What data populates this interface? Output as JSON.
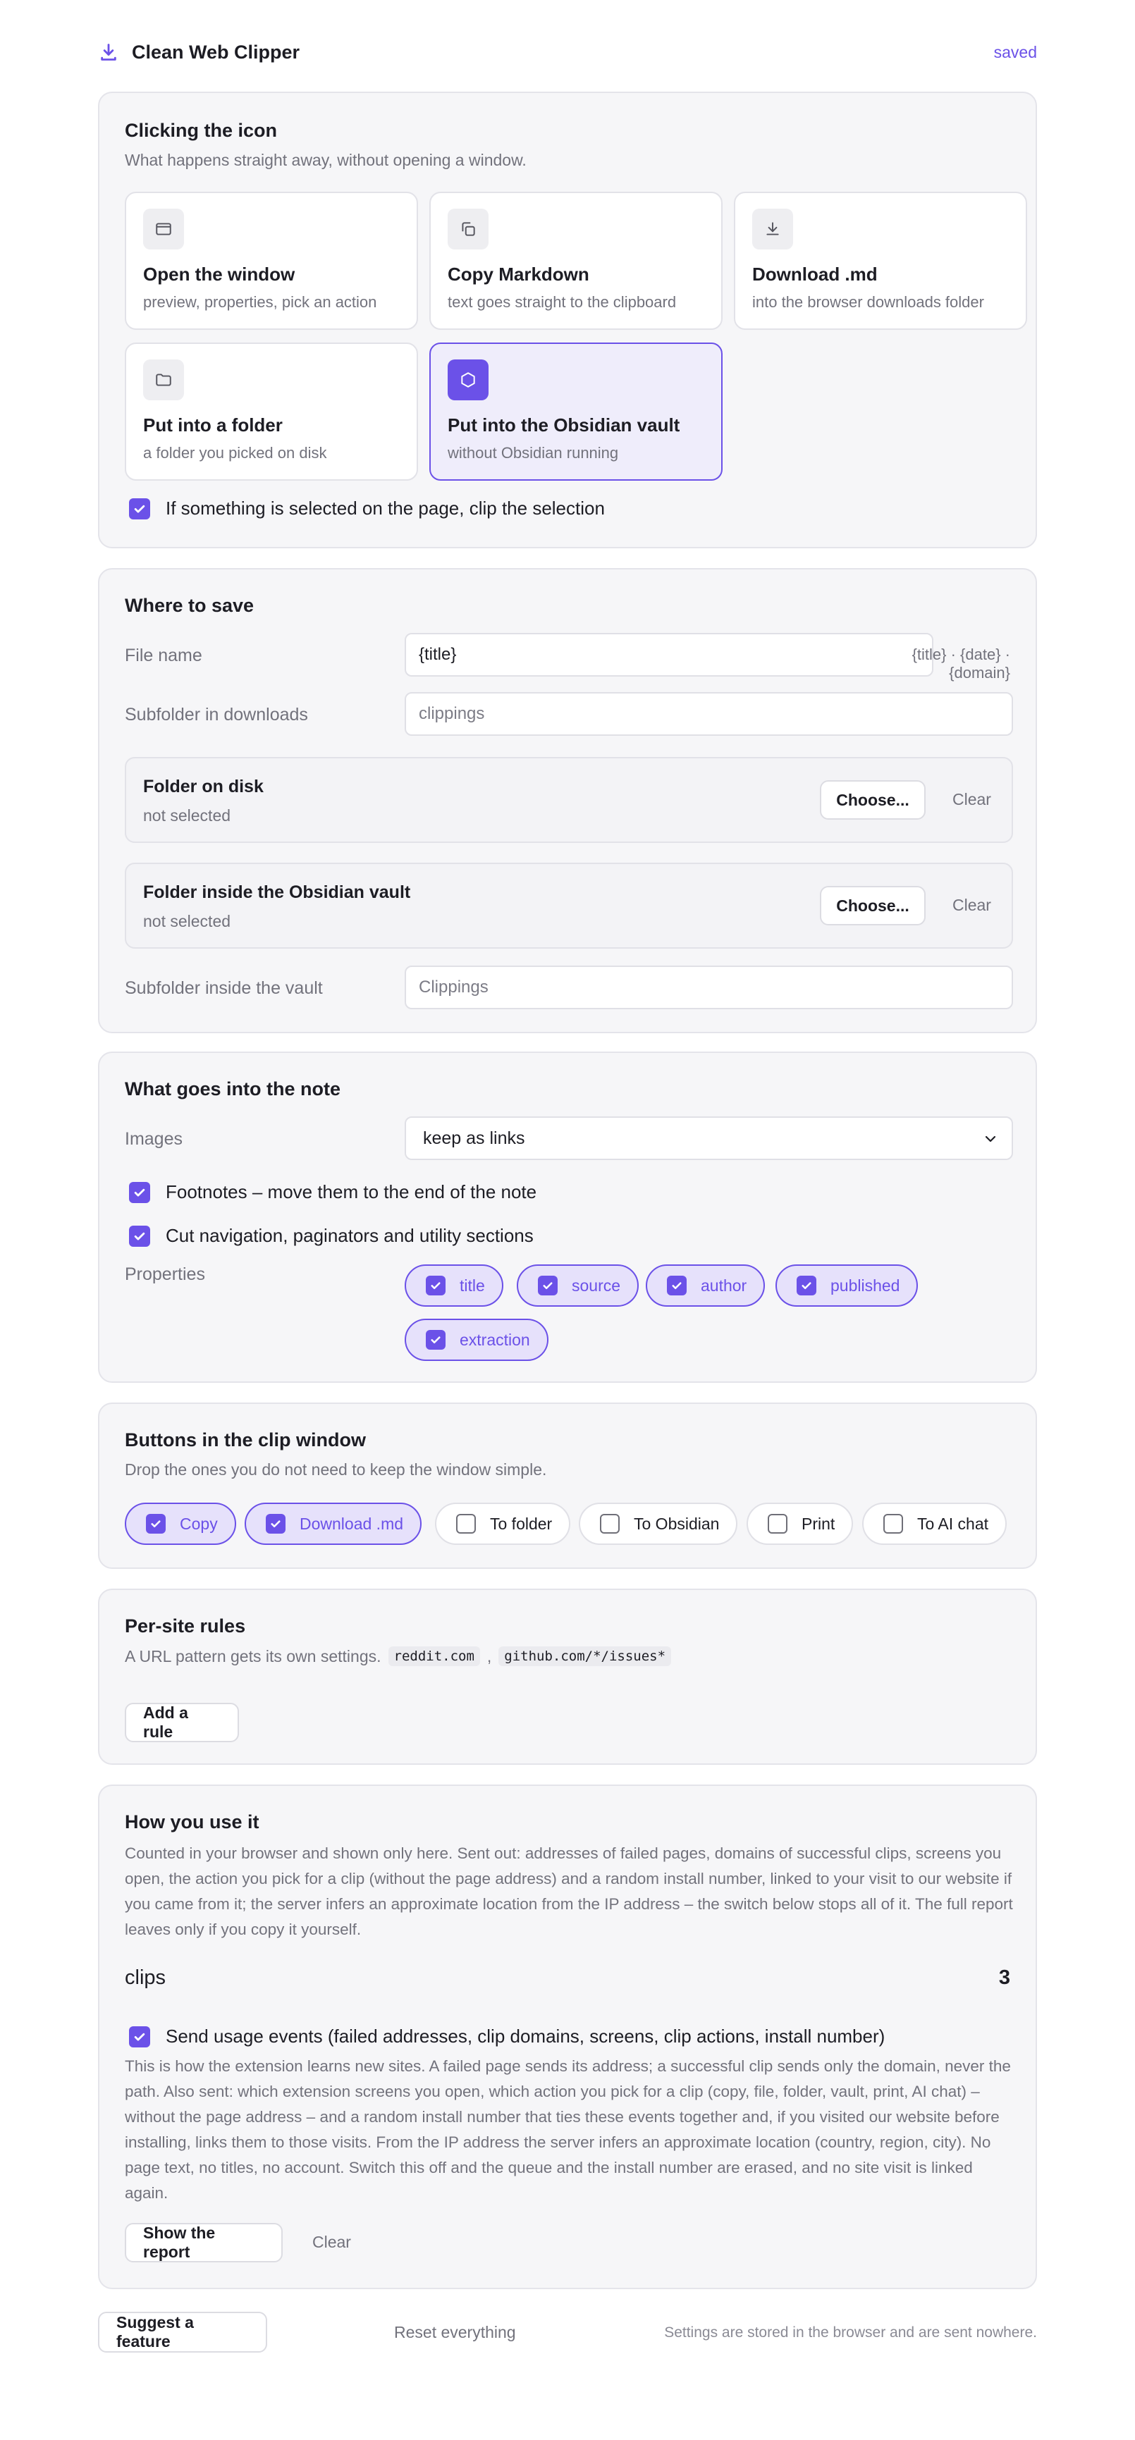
{
  "header": {
    "title": "Clean Web Clipper",
    "status": "saved"
  },
  "click_icon": {
    "title": "Clicking the icon",
    "subtitle": "What happens straight away, without opening a window.",
    "actions": [
      {
        "label": "Open the window",
        "desc": "preview, properties, pick an action",
        "icon": "window-icon",
        "selected": false
      },
      {
        "label": "Copy Markdown",
        "desc": "text goes straight to the clipboard",
        "icon": "copy-icon",
        "selected": false
      },
      {
        "label": "Download .md",
        "desc": "into the browser downloads folder",
        "icon": "download-icon",
        "selected": false
      },
      {
        "label": "Put into a folder",
        "desc": "a folder you picked on disk",
        "icon": "folder-icon",
        "selected": false
      },
      {
        "label": "Put into the Obsidian vault",
        "desc": "without Obsidian running",
        "icon": "obsidian-icon",
        "selected": true
      }
    ],
    "clip_selection": {
      "label": "If something is selected on the page, clip the selection",
      "checked": true
    }
  },
  "where": {
    "title": "Where to save",
    "file_name": {
      "label": "File name",
      "value": "{title}",
      "hint": "{title} · {date} · {domain}"
    },
    "subfolder_downloads": {
      "label": "Subfolder in downloads",
      "placeholder": "clippings"
    },
    "folder_disk": {
      "title": "Folder on disk",
      "status": "not selected",
      "choose": "Choose...",
      "clear": "Clear"
    },
    "folder_vault": {
      "title": "Folder inside the Obsidian vault",
      "status": "not selected",
      "choose": "Choose...",
      "clear": "Clear"
    },
    "subfolder_vault": {
      "label": "Subfolder inside the vault",
      "placeholder": "Clippings"
    }
  },
  "note": {
    "title": "What goes into the note",
    "images": {
      "label": "Images",
      "value": "keep as links"
    },
    "footnotes": {
      "label": "Footnotes – move them to the end of the note",
      "checked": true
    },
    "cut_nav": {
      "label": "Cut navigation, paginators and utility sections",
      "checked": true
    },
    "properties": {
      "label": "Properties",
      "items": [
        {
          "label": "title",
          "checked": true
        },
        {
          "label": "source",
          "checked": true
        },
        {
          "label": "author",
          "checked": true
        },
        {
          "label": "published",
          "checked": true
        },
        {
          "label": "extraction",
          "checked": true
        }
      ]
    }
  },
  "buttons": {
    "title": "Buttons in the clip window",
    "subtitle": "Drop the ones you do not need to keep the window simple.",
    "items": [
      {
        "label": "Copy",
        "checked": true
      },
      {
        "label": "Download .md",
        "checked": true
      },
      {
        "label": "To folder",
        "checked": false
      },
      {
        "label": "To Obsidian",
        "checked": false
      },
      {
        "label": "Print",
        "checked": false
      },
      {
        "label": "To AI chat",
        "checked": false
      }
    ]
  },
  "rules": {
    "title": "Per-site rules",
    "subtitle": "A URL pattern gets its own settings.",
    "example1": "reddit.com",
    "separator": ",",
    "example2": "github.com/*/issues*",
    "add": "Add a rule"
  },
  "usage": {
    "title": "How you use it",
    "intro": "Counted in your browser and shown only here. Sent out: addresses of failed pages, domains of successful clips, screens you open, the action you pick for a clip (without the page address) and a random install number, linked to your visit to our website if you came from it; the server infers an approximate location from the IP address – the switch below stops all of it. The full report leaves only if you copy it yourself.",
    "clips_label": "clips",
    "clips_count": "3",
    "send_events": {
      "label": "Send usage events (failed addresses, clip domains, screens, clip actions, install number)",
      "checked": true
    },
    "explain": "This is how the extension learns new sites. A failed page sends its address; a successful clip sends only the domain, never the path. Also sent: which extension screens you open, which action you pick for a clip (copy, file, folder, vault, print, AI chat) – without the page address – and a random install number that ties these events together and, if you visited our website before installing, links them to those visits. From the IP address the server infers an approximate location (country, region, city). No page text, no titles, no account. Switch this off and the queue and the install number are erased, and no site visit is linked again.",
    "show_report": "Show the report",
    "clear": "Clear"
  },
  "footer": {
    "suggest": "Suggest a feature",
    "reset": "Reset everything",
    "note": "Settings are stored in the browser and are sent nowhere."
  },
  "colors": {
    "accent": "#6b51e8",
    "card_bg": "#f6f6f8",
    "muted": "#72727c"
  }
}
